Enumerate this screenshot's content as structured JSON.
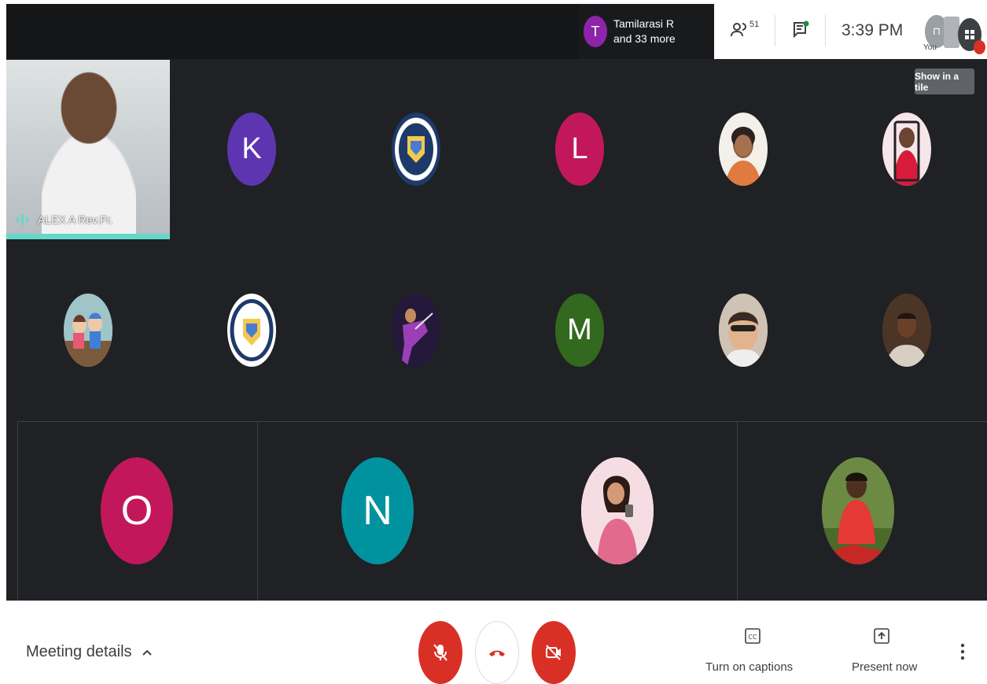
{
  "header": {
    "presenter_initial": "T",
    "presenter_line1": "Tamilarasi R",
    "presenter_line2": "and 33 more",
    "people_count": "51",
    "time": "3:39 PM",
    "self_label": "You"
  },
  "tooltip": "Show in a tile",
  "speaker": {
    "name": "ALEX A Rev.Fr."
  },
  "participants_row1": [
    {
      "initial": "K",
      "color": "#5e35b1"
    },
    {
      "initial": "",
      "kind": "college-logo"
    },
    {
      "initial": "L",
      "color": "#c2185b"
    },
    {
      "initial": "",
      "kind": "photo"
    },
    {
      "initial": "",
      "kind": "photo"
    }
  ],
  "participants_row2": [
    {
      "initial": "",
      "kind": "photo"
    },
    {
      "initial": "",
      "kind": "college-logo"
    },
    {
      "initial": "",
      "kind": "photo"
    },
    {
      "initial": "M",
      "color": "#33691e"
    },
    {
      "initial": "",
      "kind": "photo"
    },
    {
      "initial": "",
      "kind": "photo"
    }
  ],
  "participants_row3": [
    {
      "initial": "O",
      "color": "#c2185b"
    },
    {
      "initial": "N",
      "color": "#00838f"
    },
    {
      "initial": "",
      "kind": "photo"
    },
    {
      "initial": "",
      "kind": "photo"
    }
  ],
  "bottom": {
    "meeting_details": "Meeting details",
    "captions": "Turn on captions",
    "present": "Present now"
  },
  "icons": {
    "people": "people-icon",
    "chat": "chat-icon",
    "mic": "mic-off-icon",
    "hangup": "hangup-icon",
    "camera": "camera-off-icon",
    "cc": "cc-icon",
    "present": "present-icon",
    "more": "more-vert-icon"
  }
}
